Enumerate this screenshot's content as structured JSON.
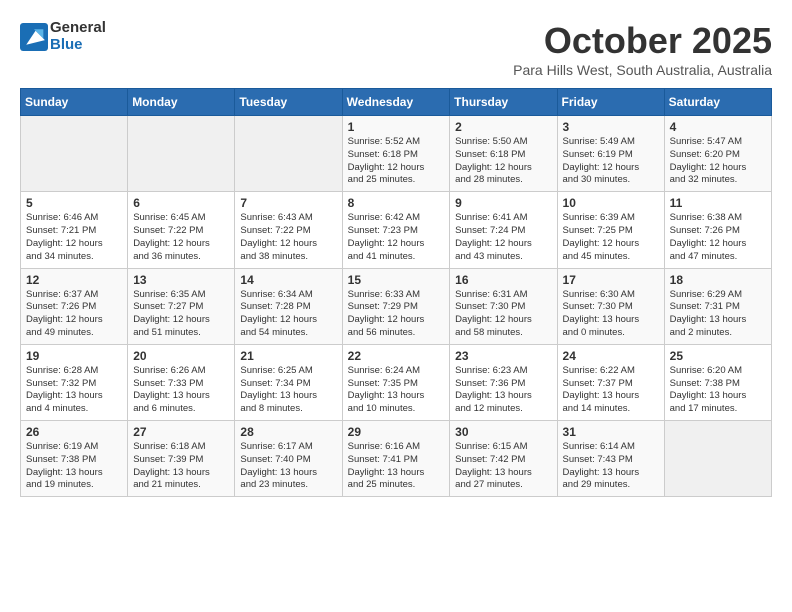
{
  "logo": {
    "line1": "General",
    "line2": "Blue"
  },
  "title": "October 2025",
  "subtitle": "Para Hills West, South Australia, Australia",
  "days_header": [
    "Sunday",
    "Monday",
    "Tuesday",
    "Wednesday",
    "Thursday",
    "Friday",
    "Saturday"
  ],
  "weeks": [
    [
      {
        "day": "",
        "info": ""
      },
      {
        "day": "",
        "info": ""
      },
      {
        "day": "",
        "info": ""
      },
      {
        "day": "1",
        "info": "Sunrise: 5:52 AM\nSunset: 6:18 PM\nDaylight: 12 hours\nand 25 minutes."
      },
      {
        "day": "2",
        "info": "Sunrise: 5:50 AM\nSunset: 6:18 PM\nDaylight: 12 hours\nand 28 minutes."
      },
      {
        "day": "3",
        "info": "Sunrise: 5:49 AM\nSunset: 6:19 PM\nDaylight: 12 hours\nand 30 minutes."
      },
      {
        "day": "4",
        "info": "Sunrise: 5:47 AM\nSunset: 6:20 PM\nDaylight: 12 hours\nand 32 minutes."
      }
    ],
    [
      {
        "day": "5",
        "info": "Sunrise: 6:46 AM\nSunset: 7:21 PM\nDaylight: 12 hours\nand 34 minutes."
      },
      {
        "day": "6",
        "info": "Sunrise: 6:45 AM\nSunset: 7:22 PM\nDaylight: 12 hours\nand 36 minutes."
      },
      {
        "day": "7",
        "info": "Sunrise: 6:43 AM\nSunset: 7:22 PM\nDaylight: 12 hours\nand 38 minutes."
      },
      {
        "day": "8",
        "info": "Sunrise: 6:42 AM\nSunset: 7:23 PM\nDaylight: 12 hours\nand 41 minutes."
      },
      {
        "day": "9",
        "info": "Sunrise: 6:41 AM\nSunset: 7:24 PM\nDaylight: 12 hours\nand 43 minutes."
      },
      {
        "day": "10",
        "info": "Sunrise: 6:39 AM\nSunset: 7:25 PM\nDaylight: 12 hours\nand 45 minutes."
      },
      {
        "day": "11",
        "info": "Sunrise: 6:38 AM\nSunset: 7:26 PM\nDaylight: 12 hours\nand 47 minutes."
      }
    ],
    [
      {
        "day": "12",
        "info": "Sunrise: 6:37 AM\nSunset: 7:26 PM\nDaylight: 12 hours\nand 49 minutes."
      },
      {
        "day": "13",
        "info": "Sunrise: 6:35 AM\nSunset: 7:27 PM\nDaylight: 12 hours\nand 51 minutes."
      },
      {
        "day": "14",
        "info": "Sunrise: 6:34 AM\nSunset: 7:28 PM\nDaylight: 12 hours\nand 54 minutes."
      },
      {
        "day": "15",
        "info": "Sunrise: 6:33 AM\nSunset: 7:29 PM\nDaylight: 12 hours\nand 56 minutes."
      },
      {
        "day": "16",
        "info": "Sunrise: 6:31 AM\nSunset: 7:30 PM\nDaylight: 12 hours\nand 58 minutes."
      },
      {
        "day": "17",
        "info": "Sunrise: 6:30 AM\nSunset: 7:30 PM\nDaylight: 13 hours\nand 0 minutes."
      },
      {
        "day": "18",
        "info": "Sunrise: 6:29 AM\nSunset: 7:31 PM\nDaylight: 13 hours\nand 2 minutes."
      }
    ],
    [
      {
        "day": "19",
        "info": "Sunrise: 6:28 AM\nSunset: 7:32 PM\nDaylight: 13 hours\nand 4 minutes."
      },
      {
        "day": "20",
        "info": "Sunrise: 6:26 AM\nSunset: 7:33 PM\nDaylight: 13 hours\nand 6 minutes."
      },
      {
        "day": "21",
        "info": "Sunrise: 6:25 AM\nSunset: 7:34 PM\nDaylight: 13 hours\nand 8 minutes."
      },
      {
        "day": "22",
        "info": "Sunrise: 6:24 AM\nSunset: 7:35 PM\nDaylight: 13 hours\nand 10 minutes."
      },
      {
        "day": "23",
        "info": "Sunrise: 6:23 AM\nSunset: 7:36 PM\nDaylight: 13 hours\nand 12 minutes."
      },
      {
        "day": "24",
        "info": "Sunrise: 6:22 AM\nSunset: 7:37 PM\nDaylight: 13 hours\nand 14 minutes."
      },
      {
        "day": "25",
        "info": "Sunrise: 6:20 AM\nSunset: 7:38 PM\nDaylight: 13 hours\nand 17 minutes."
      }
    ],
    [
      {
        "day": "26",
        "info": "Sunrise: 6:19 AM\nSunset: 7:38 PM\nDaylight: 13 hours\nand 19 minutes."
      },
      {
        "day": "27",
        "info": "Sunrise: 6:18 AM\nSunset: 7:39 PM\nDaylight: 13 hours\nand 21 minutes."
      },
      {
        "day": "28",
        "info": "Sunrise: 6:17 AM\nSunset: 7:40 PM\nDaylight: 13 hours\nand 23 minutes."
      },
      {
        "day": "29",
        "info": "Sunrise: 6:16 AM\nSunset: 7:41 PM\nDaylight: 13 hours\nand 25 minutes."
      },
      {
        "day": "30",
        "info": "Sunrise: 6:15 AM\nSunset: 7:42 PM\nDaylight: 13 hours\nand 27 minutes."
      },
      {
        "day": "31",
        "info": "Sunrise: 6:14 AM\nSunset: 7:43 PM\nDaylight: 13 hours\nand 29 minutes."
      },
      {
        "day": "",
        "info": ""
      }
    ]
  ]
}
